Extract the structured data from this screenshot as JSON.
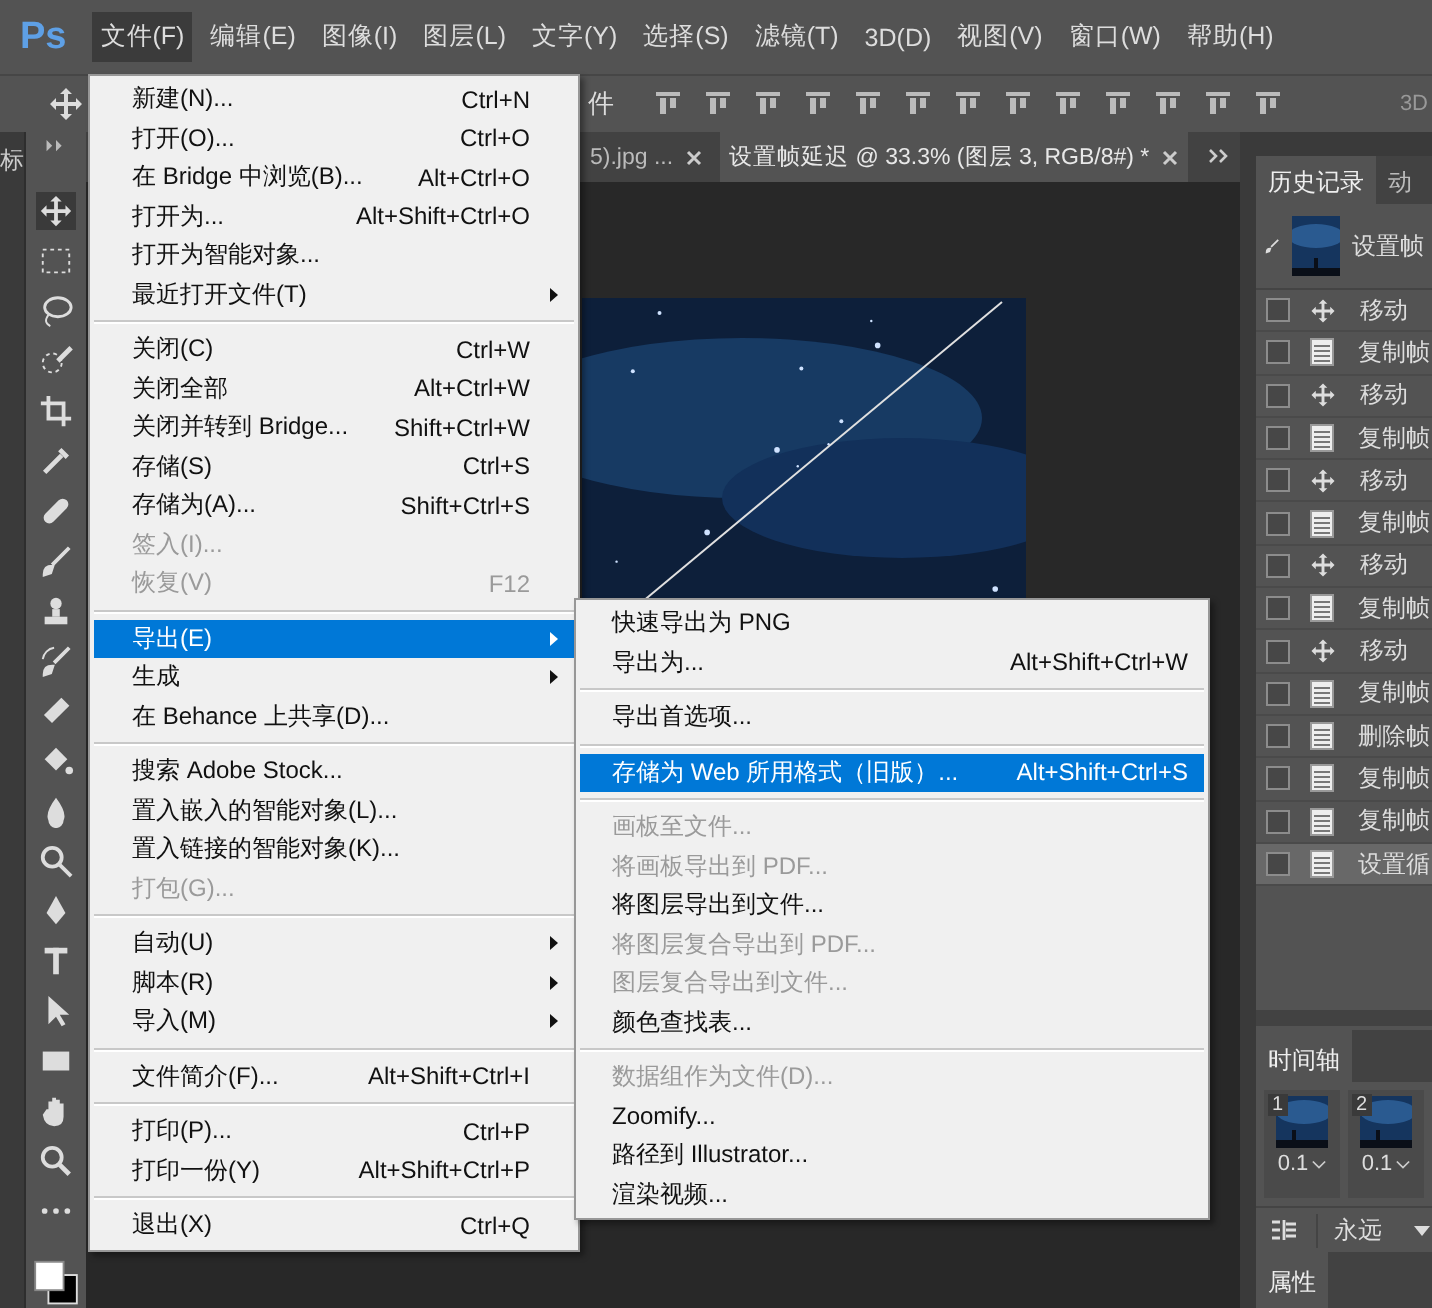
{
  "app": {
    "logo": "Ps"
  },
  "menu_bar": [
    {
      "label": "文件(F)",
      "selected": true
    },
    {
      "label": "编辑(E)",
      "selected": false
    },
    {
      "label": "图像(I)",
      "selected": false
    },
    {
      "label": "图层(L)",
      "selected": false
    },
    {
      "label": "文字(Y)",
      "selected": false
    },
    {
      "label": "选择(S)",
      "selected": false
    },
    {
      "label": "滤镜(T)",
      "selected": false
    },
    {
      "label": "3D(D)",
      "selected": false
    },
    {
      "label": "视图(V)",
      "selected": false
    },
    {
      "label": "窗口(W)",
      "selected": false
    },
    {
      "label": "帮助(H)",
      "selected": false
    }
  ],
  "options_bar": {
    "fragment": "件",
    "label_3d": "3D"
  },
  "left_edge_fragment": "标",
  "document_tabs": [
    {
      "title": "5).jpg ...",
      "selected": false
    },
    {
      "title": "设置帧延迟 @ 33.3% (图层 3, RGB/8#) *",
      "selected": true
    }
  ],
  "file_menu": [
    [
      {
        "label": "新建(N)...",
        "shortcut": "Ctrl+N",
        "disabled": false,
        "submenu": false,
        "selected": false
      },
      {
        "label": "打开(O)...",
        "shortcut": "Ctrl+O",
        "disabled": false,
        "submenu": false,
        "selected": false
      },
      {
        "label": "在 Bridge 中浏览(B)...",
        "shortcut": "Alt+Ctrl+O",
        "disabled": false,
        "submenu": false,
        "selected": false
      },
      {
        "label": "打开为...",
        "shortcut": "Alt+Shift+Ctrl+O",
        "disabled": false,
        "submenu": false,
        "selected": false
      },
      {
        "label": "打开为智能对象...",
        "disabled": false,
        "submenu": false,
        "selected": false
      },
      {
        "label": "最近打开文件(T)",
        "disabled": false,
        "submenu": true,
        "selected": false
      }
    ],
    [
      {
        "label": "关闭(C)",
        "shortcut": "Ctrl+W",
        "disabled": false,
        "submenu": false,
        "selected": false
      },
      {
        "label": "关闭全部",
        "shortcut": "Alt+Ctrl+W",
        "disabled": false,
        "submenu": false,
        "selected": false
      },
      {
        "label": "关闭并转到 Bridge...",
        "shortcut": "Shift+Ctrl+W",
        "disabled": false,
        "submenu": false,
        "selected": false
      },
      {
        "label": "存储(S)",
        "shortcut": "Ctrl+S",
        "disabled": false,
        "submenu": false,
        "selected": false
      },
      {
        "label": "存储为(A)...",
        "shortcut": "Shift+Ctrl+S",
        "disabled": false,
        "submenu": false,
        "selected": false
      },
      {
        "label": "签入(I)...",
        "disabled": true,
        "submenu": false,
        "selected": false
      },
      {
        "label": "恢复(V)",
        "shortcut": "F12",
        "disabled": true,
        "submenu": false,
        "selected": false
      }
    ],
    [
      {
        "label": "导出(E)",
        "disabled": false,
        "submenu": true,
        "selected": true
      },
      {
        "label": "生成",
        "disabled": false,
        "submenu": true,
        "selected": false
      },
      {
        "label": "在 Behance 上共享(D)...",
        "disabled": false,
        "submenu": false,
        "selected": false
      }
    ],
    [
      {
        "label": "搜索 Adobe Stock...",
        "disabled": false,
        "submenu": false,
        "selected": false
      },
      {
        "label": "置入嵌入的智能对象(L)...",
        "disabled": false,
        "submenu": false,
        "selected": false
      },
      {
        "label": "置入链接的智能对象(K)...",
        "disabled": false,
        "submenu": false,
        "selected": false
      },
      {
        "label": "打包(G)...",
        "disabled": true,
        "submenu": false,
        "selected": false
      }
    ],
    [
      {
        "label": "自动(U)",
        "disabled": false,
        "submenu": true,
        "selected": false
      },
      {
        "label": "脚本(R)",
        "disabled": false,
        "submenu": true,
        "selected": false
      },
      {
        "label": "导入(M)",
        "disabled": false,
        "submenu": true,
        "selected": false
      }
    ],
    [
      {
        "label": "文件简介(F)...",
        "shortcut": "Alt+Shift+Ctrl+I",
        "disabled": false,
        "submenu": false,
        "selected": false
      }
    ],
    [
      {
        "label": "打印(P)...",
        "shortcut": "Ctrl+P",
        "disabled": false,
        "submenu": false,
        "selected": false
      },
      {
        "label": "打印一份(Y)",
        "shortcut": "Alt+Shift+Ctrl+P",
        "disabled": false,
        "submenu": false,
        "selected": false
      }
    ],
    [
      {
        "label": "退出(X)",
        "shortcut": "Ctrl+Q",
        "disabled": false,
        "submenu": false,
        "selected": false
      }
    ]
  ],
  "export_submenu": [
    [
      {
        "label": "快速导出为 PNG",
        "disabled": false,
        "selected": false
      },
      {
        "label": "导出为...",
        "shortcut": "Alt+Shift+Ctrl+W",
        "disabled": false,
        "selected": false
      }
    ],
    [
      {
        "label": "导出首选项...",
        "disabled": false,
        "selected": false
      }
    ],
    [
      {
        "label": "存储为 Web 所用格式（旧版）...",
        "shortcut": "Alt+Shift+Ctrl+S",
        "disabled": false,
        "selected": true
      }
    ],
    [
      {
        "label": "画板至文件...",
        "disabled": true,
        "selected": false
      },
      {
        "label": "将画板导出到 PDF...",
        "disabled": true,
        "selected": false
      },
      {
        "label": "将图层导出到文件...",
        "disabled": false,
        "selected": false
      },
      {
        "label": "将图层复合导出到 PDF...",
        "disabled": true,
        "selected": false
      },
      {
        "label": "图层复合导出到文件...",
        "disabled": true,
        "selected": false
      },
      {
        "label": "颜色查找表...",
        "disabled": false,
        "selected": false
      }
    ],
    [
      {
        "label": "数据组作为文件(D)...",
        "disabled": true,
        "selected": false
      },
      {
        "label": "Zoomify...",
        "disabled": false,
        "selected": false
      },
      {
        "label": "路径到 Illustrator...",
        "disabled": false,
        "selected": false
      },
      {
        "label": "渲染视频...",
        "disabled": false,
        "selected": false
      }
    ]
  ],
  "history_panel": {
    "tabs": [
      {
        "label": "历史记录",
        "selected": true
      },
      {
        "label": "动",
        "selected": false
      }
    ],
    "snapshot": "设置帧",
    "items": [
      {
        "kind": "move",
        "label": "移动",
        "selected": false
      },
      {
        "kind": "doc",
        "label": "复制帧",
        "selected": false
      },
      {
        "kind": "move",
        "label": "移动",
        "selected": false
      },
      {
        "kind": "doc",
        "label": "复制帧",
        "selected": false
      },
      {
        "kind": "move",
        "label": "移动",
        "selected": false
      },
      {
        "kind": "doc",
        "label": "复制帧",
        "selected": false
      },
      {
        "kind": "move",
        "label": "移动",
        "selected": false
      },
      {
        "kind": "doc",
        "label": "复制帧",
        "selected": false
      },
      {
        "kind": "move",
        "label": "移动",
        "selected": false
      },
      {
        "kind": "doc",
        "label": "复制帧",
        "selected": false
      },
      {
        "kind": "doc",
        "label": "删除帧",
        "selected": false
      },
      {
        "kind": "doc",
        "label": "复制帧",
        "selected": false
      },
      {
        "kind": "doc",
        "label": "复制帧",
        "selected": false
      },
      {
        "kind": "doc",
        "label": "设置循",
        "selected": true
      }
    ]
  },
  "timeline_panel": {
    "title": "时间轴",
    "frames": [
      {
        "number": "1",
        "delay": "0.1"
      },
      {
        "number": "2",
        "delay": "0.1"
      }
    ],
    "loop": "永远"
  },
  "properties_tab": "属性"
}
